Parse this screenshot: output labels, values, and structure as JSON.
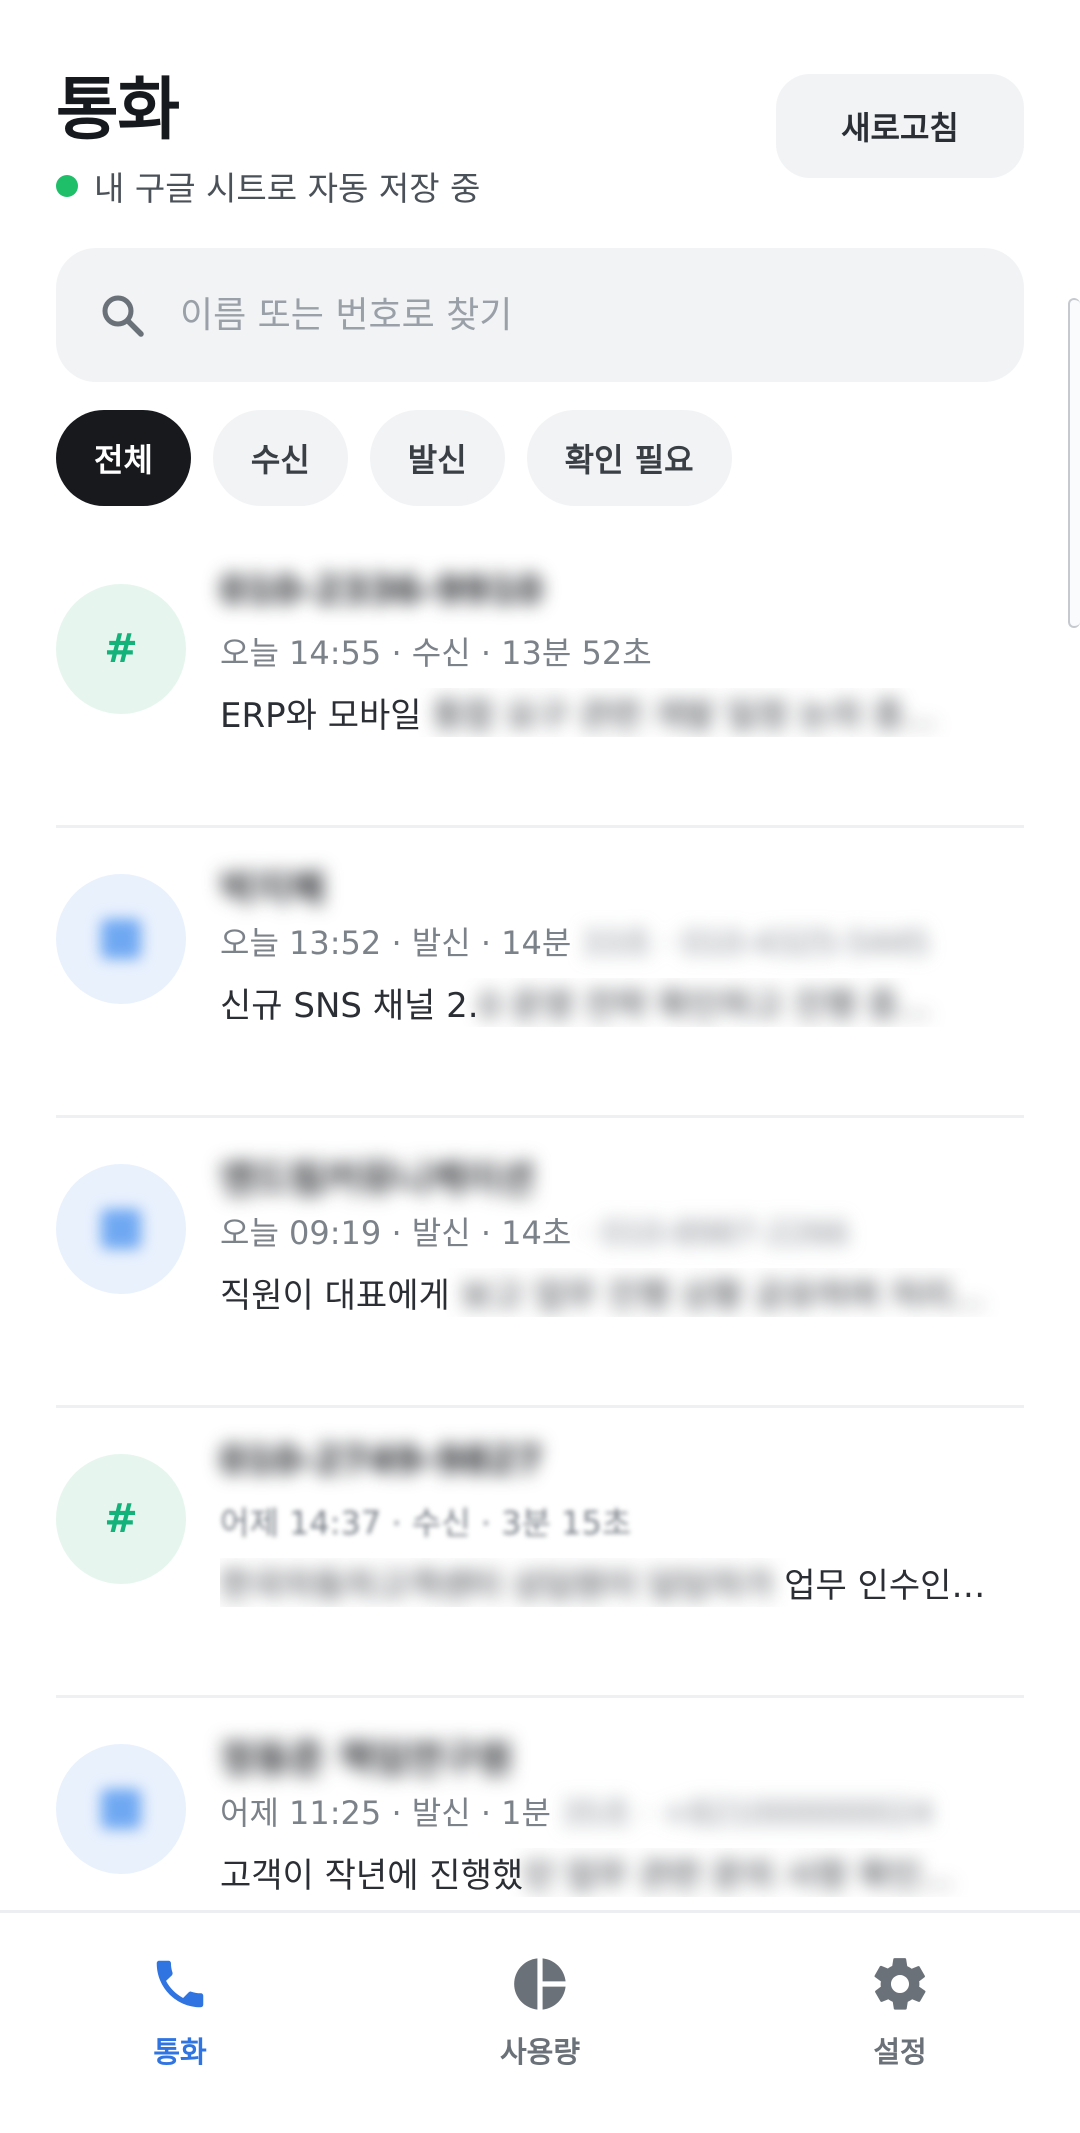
{
  "header": {
    "title": "통화",
    "save_status": "내 구글 시트로 자동 저장 중",
    "refresh_label": "새로고침"
  },
  "search": {
    "placeholder": "이름 또는 번호로 찾기"
  },
  "filters": [
    {
      "label": "전체",
      "active": true
    },
    {
      "label": "수신",
      "active": false
    },
    {
      "label": "발신",
      "active": false
    },
    {
      "label": "확인 필요",
      "active": false
    }
  ],
  "calls": [
    {
      "avatar": "#",
      "avatar_color": "green",
      "name": "010-2336-9910",
      "meta_visible": "오늘 14:55 · 수신 · 13분 52초",
      "meta_hidden": "",
      "summary_visible": "ERP와 모바일 ",
      "summary_hidden": "통합 요구 관련 개발 일정 논의 중..."
    },
    {
      "avatar": "",
      "avatar_color": "blue",
      "name": "박지혜",
      "meta_visible": "오늘 13:52 · 발신 · 14분",
      "meta_hidden": " 33초 · 010-4325-5445",
      "summary_visible": "신규 SNS 채널 2.",
      "summary_hidden": "0 운영 전략 확인하고 진행 중..."
    },
    {
      "avatar": "",
      "avatar_color": "blue",
      "name": "엔드림커뮤니케이션",
      "meta_visible": "오늘 09:19 · 발신 · 14초",
      "meta_hidden": " · 010-8987-2266",
      "summary_visible": "직원이 대표에게 ",
      "summary_hidden": "보고 업무 진행 상황 공유하며 처리..."
    },
    {
      "avatar": "#",
      "avatar_color": "green",
      "name": "010-2749-9827",
      "meta_visible": "어제 14:37 · 수신 · 3분 15초",
      "meta_hidden": "",
      "summary_visible": "업무 인수인…",
      "summary_hidden": "한국자동차고객센터 상담원이 담당자가 "
    },
    {
      "avatar": "",
      "avatar_color": "blue",
      "name": "정동준 책임연구원",
      "meta_visible": "어제 11:25 · 발신 · 1분",
      "meta_hidden": " 35초 · +821000000024",
      "summary_visible": "고객이 작년에 진행했",
      "summary_hidden": "던 업무 관련 문의 사항 확인..."
    }
  ],
  "bottom_nav": [
    {
      "label": "통화",
      "icon": "phone-icon",
      "active": true
    },
    {
      "label": "사용량",
      "icon": "pie-chart-icon",
      "active": false
    },
    {
      "label": "설정",
      "icon": "gear-icon",
      "active": false
    }
  ],
  "colors": {
    "accent": "#2f74e0",
    "status_green": "#1fbf6a",
    "chip_active": "#17191d"
  }
}
